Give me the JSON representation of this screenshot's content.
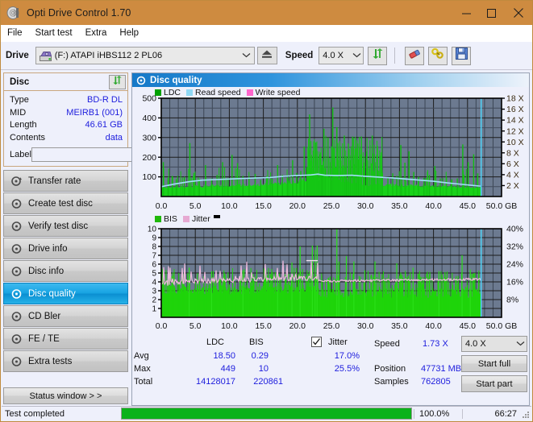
{
  "window": {
    "title": "Opti Drive Control 1.70",
    "icon": "disc-icon",
    "minimize": "–",
    "maximize": "☐",
    "close": "✕"
  },
  "menubar": {
    "items": [
      {
        "label": "File",
        "name": "menu-file"
      },
      {
        "label": "Start test",
        "name": "menu-start-test"
      },
      {
        "label": "Extra",
        "name": "menu-extra"
      },
      {
        "label": "Help",
        "name": "menu-help"
      }
    ]
  },
  "toolbar": {
    "drive_label": "Drive",
    "drive_value": "(F:)  ATAPI iHBS112  2 PL06",
    "drive_icon": "drive-icon",
    "eject_icon": "eject-icon",
    "speed_label": "Speed",
    "speed_value": "4.0 X",
    "refresh_icon": "refresh-icon",
    "erase_icon": "eraser-icon",
    "tools_icon": "tools-icon",
    "save_icon": "save-icon"
  },
  "sidebar": {
    "disc_panel": {
      "title": "Disc",
      "refresh_icon": "refresh-icon",
      "rows": [
        {
          "key": "Type",
          "value": "BD-R DL"
        },
        {
          "key": "MID",
          "value": "MEIRB1 (001)"
        },
        {
          "key": "Length",
          "value": "46.61 GB"
        },
        {
          "key": "Contents",
          "value": "data"
        }
      ],
      "label_key": "Label",
      "label_value": "",
      "label_placeholder": "",
      "label_button_icon": "disc-icon"
    },
    "nav": [
      {
        "label": "Transfer rate",
        "name": "sidebar-item-transfer-rate",
        "active": false
      },
      {
        "label": "Create test disc",
        "name": "sidebar-item-create-test-disc",
        "active": false
      },
      {
        "label": "Verify test disc",
        "name": "sidebar-item-verify-test-disc",
        "active": false
      },
      {
        "label": "Drive info",
        "name": "sidebar-item-drive-info",
        "active": false
      },
      {
        "label": "Disc info",
        "name": "sidebar-item-disc-info",
        "active": false
      },
      {
        "label": "Disc quality",
        "name": "sidebar-item-disc-quality",
        "active": true
      },
      {
        "label": "CD Bler",
        "name": "sidebar-item-cd-bler",
        "active": false
      },
      {
        "label": "FE / TE",
        "name": "sidebar-item-fe-te",
        "active": false
      },
      {
        "label": "Extra tests",
        "name": "sidebar-item-extra-tests",
        "active": false
      }
    ],
    "status_window_button": "Status window > >"
  },
  "panel": {
    "title": "Disc quality",
    "icon": "disc-quality-icon"
  },
  "stats": {
    "col_ldc": "LDC",
    "col_bis": "BIS",
    "jitter_label": "Jitter",
    "jitter_checked": true,
    "rows": [
      {
        "label": "Avg",
        "ldc": "18.50",
        "bis": "0.29",
        "jitter": "17.0%"
      },
      {
        "label": "Max",
        "ldc": "449",
        "bis": "10",
        "jitter": "25.5%"
      },
      {
        "label": "Total",
        "ldc": "14128017",
        "bis": "220861",
        "jitter": ""
      }
    ],
    "speed_key": "Speed",
    "speed_value": "1.73 X",
    "position_key": "Position",
    "position_value": "47731 MB",
    "samples_key": "Samples",
    "samples_value": "762805",
    "speed_select": "4.0 X",
    "start_full": "Start full",
    "start_part": "Start part"
  },
  "statusbar": {
    "message": "Test completed",
    "percent_label": "100.0%",
    "percent_value": 100,
    "elapsed": "66:27"
  },
  "colors": {
    "title_bar": "#ce8b40",
    "accent_blue": "#1679c8",
    "ldc_green": "#00c000",
    "read_speed": "#8fd8f4",
    "write_speed": "#ff66cc",
    "bis_green": "#1fd40a",
    "jitter_pink": "#e6a9d2",
    "value_blue": "#1d1ddd",
    "plot_bg": "#6c7a90",
    "progress_green": "#0bb21a"
  },
  "chart_data": [
    {
      "type": "area",
      "name": "ldc-chart",
      "title": "",
      "xlabel": "GB",
      "ylabel": "",
      "xlim": [
        0,
        50
      ],
      "ylim": [
        0,
        500
      ],
      "y2lim": [
        0,
        18
      ],
      "xticks": [
        "0.0",
        "5.0",
        "10.0",
        "15.0",
        "20.0",
        "25.0",
        "30.0",
        "35.0",
        "40.0",
        "45.0",
        "50.0 GB"
      ],
      "yticks": [
        "100",
        "200",
        "300",
        "400",
        "500"
      ],
      "y2ticks": [
        "2 X",
        "4 X",
        "6 X",
        "8 X",
        "10 X",
        "12 X",
        "14 X",
        "16 X",
        "18 X"
      ],
      "grid": true,
      "legend": [
        {
          "label": "LDC",
          "color": "#00b000"
        },
        {
          "label": "Read speed",
          "color": "#8fd8f4"
        },
        {
          "label": "Write speed",
          "color": "#ff66cc"
        }
      ],
      "series": [
        {
          "name": "LDC",
          "color": "#00c000",
          "type": "area",
          "x_end": 47.0,
          "baseline": [
            40,
            42,
            38,
            40,
            42,
            44,
            43,
            45,
            44,
            46,
            45,
            47,
            46,
            48,
            47,
            49,
            48,
            50,
            49,
            51,
            50,
            52,
            51,
            53,
            52,
            54,
            53,
            55,
            56,
            57,
            58,
            60,
            62,
            64,
            66,
            70,
            74,
            80,
            88,
            100,
            112,
            92,
            74,
            68,
            64,
            62,
            60,
            58,
            57,
            56,
            55,
            54,
            53,
            52,
            52,
            51,
            51,
            50,
            50,
            49,
            49,
            48,
            48,
            47,
            47,
            46,
            46,
            45,
            45,
            44,
            44,
            43,
            43,
            42,
            42,
            42,
            41,
            41,
            40,
            40
          ],
          "spikes": [
            [
              0.3,
              175
            ],
            [
              1.0,
              95
            ],
            [
              1.6,
              105
            ],
            [
              2.2,
              88
            ],
            [
              3.4,
              100
            ],
            [
              4.2,
              272
            ],
            [
              4.8,
              120
            ],
            [
              5.6,
              88
            ],
            [
              6.5,
              160
            ],
            [
              7.4,
              92
            ],
            [
              8.2,
              110
            ],
            [
              9.0,
              175
            ],
            [
              9.8,
              95
            ],
            [
              10.4,
              212
            ],
            [
              11.2,
              170
            ],
            [
              12.0,
              105
            ],
            [
              12.9,
              95
            ],
            [
              13.8,
              115
            ],
            [
              14.6,
              85
            ],
            [
              15.5,
              105
            ],
            [
              16.3,
              90
            ],
            [
              17.1,
              160
            ],
            [
              17.8,
              110
            ],
            [
              18.6,
              95
            ],
            [
              19.3,
              185
            ],
            [
              19.9,
              120
            ],
            [
              20.5,
              130
            ],
            [
              21.0,
              255
            ],
            [
              21.4,
              150
            ],
            [
              21.8,
              418
            ],
            [
              22.1,
              200
            ],
            [
              22.4,
              165
            ],
            [
              22.7,
              275
            ],
            [
              23.0,
              190
            ],
            [
              23.3,
              215
            ],
            [
              23.6,
              160
            ],
            [
              23.9,
              345
            ],
            [
              24.2,
              205
            ],
            [
              24.5,
              300
            ],
            [
              24.8,
              175
            ],
            [
              25.0,
              255
            ],
            [
              25.2,
              453
            ],
            [
              25.5,
              200
            ],
            [
              25.8,
              353
            ],
            [
              26.0,
              185
            ],
            [
              26.3,
              255
            ],
            [
              26.6,
              150
            ],
            [
              26.9,
              310
            ],
            [
              27.2,
              205
            ],
            [
              27.5,
              270
            ],
            [
              27.8,
              185
            ],
            [
              28.1,
              305
            ],
            [
              28.4,
              165
            ],
            [
              28.7,
              245
            ],
            [
              29.0,
              190
            ],
            [
              29.4,
              305
            ],
            [
              29.8,
              155
            ],
            [
              30.2,
              230
            ],
            [
              30.6,
              145
            ],
            [
              31.0,
              310
            ],
            [
              31.4,
              175
            ],
            [
              31.8,
              135
            ],
            [
              32.5,
              120
            ],
            [
              33.3,
              95
            ],
            [
              34.0,
              118
            ],
            [
              34.6,
              105
            ],
            [
              35.2,
              262
            ],
            [
              35.8,
              172
            ],
            [
              36.4,
              230
            ],
            [
              37.1,
              125
            ],
            [
              37.8,
              100
            ],
            [
              38.6,
              95
            ],
            [
              39.4,
              110
            ],
            [
              40.2,
              155
            ],
            [
              41.0,
              92
            ],
            [
              41.9,
              98
            ],
            [
              42.7,
              88
            ],
            [
              43.5,
              92
            ],
            [
              44.3,
              265
            ],
            [
              45.1,
              175
            ],
            [
              45.9,
              215
            ],
            [
              46.5,
              118
            ]
          ]
        },
        {
          "name": "Read speed",
          "color": "#8fd8f4",
          "type": "line",
          "axis": "y2",
          "points": [
            [
              0.0,
              1.8
            ],
            [
              2.0,
              2.3
            ],
            [
              4.0,
              2.7
            ],
            [
              6.0,
              3.0
            ],
            [
              8.0,
              3.1
            ],
            [
              10.0,
              3.2
            ],
            [
              12.0,
              3.3
            ],
            [
              14.0,
              3.4
            ],
            [
              16.0,
              3.5
            ],
            [
              18.0,
              3.7
            ],
            [
              20.0,
              3.85
            ],
            [
              22.0,
              3.95
            ],
            [
              23.0,
              4.1
            ],
            [
              24.0,
              3.9
            ],
            [
              26.0,
              3.85
            ],
            [
              28.0,
              3.9
            ],
            [
              30.0,
              3.7
            ],
            [
              32.0,
              3.55
            ],
            [
              34.0,
              3.4
            ],
            [
              36.0,
              3.2
            ],
            [
              38.0,
              3.0
            ],
            [
              40.0,
              2.8
            ],
            [
              42.0,
              2.5
            ],
            [
              44.0,
              2.25
            ],
            [
              46.0,
              2.0
            ],
            [
              46.9,
              1.9
            ]
          ],
          "cursor_x": 47.0
        },
        {
          "name": "Write speed",
          "color": "#ff66cc",
          "type": "line",
          "points": []
        }
      ]
    },
    {
      "type": "area",
      "name": "bis-jitter-chart",
      "title": "",
      "xlabel": "GB",
      "ylabel": "",
      "xlim": [
        0,
        50
      ],
      "ylim": [
        0,
        10
      ],
      "y2lim": [
        0,
        40
      ],
      "xticks": [
        "0.0",
        "5.0",
        "10.0",
        "15.0",
        "20.0",
        "25.0",
        "30.0",
        "35.0",
        "40.0",
        "45.0",
        "50.0 GB"
      ],
      "yticks": [
        "1",
        "2",
        "3",
        "4",
        "5",
        "6",
        "7",
        "8",
        "9",
        "10"
      ],
      "y2ticks": [
        "8%",
        "16%",
        "24%",
        "32%",
        "40%"
      ],
      "grid": true,
      "legend": [
        {
          "label": "BIS",
          "color": "#1fd40a"
        },
        {
          "label": "Jitter",
          "color": "#e6a9d2"
        }
      ],
      "series": [
        {
          "name": "BIS",
          "color": "#1fd40a",
          "type": "area",
          "x_end": 47.0,
          "baseline_low": 2.6,
          "baseline_high_after": 23.0,
          "baseline_after": 2.2,
          "spike_top": 3.6
        },
        {
          "name": "Jitter",
          "color": "#e6a9d2",
          "type": "line",
          "axis": "y2",
          "segment_a": {
            "range": [
              0,
              23
            ],
            "avg_pct": 17.5,
            "band_pct": [
              14,
              26
            ]
          },
          "segment_b": {
            "range": [
              23,
              47
            ],
            "avg_pct": 16.4,
            "band_pct": [
              15.5,
              17.5
            ]
          },
          "cursor_x": 47.0
        }
      ]
    }
  ]
}
